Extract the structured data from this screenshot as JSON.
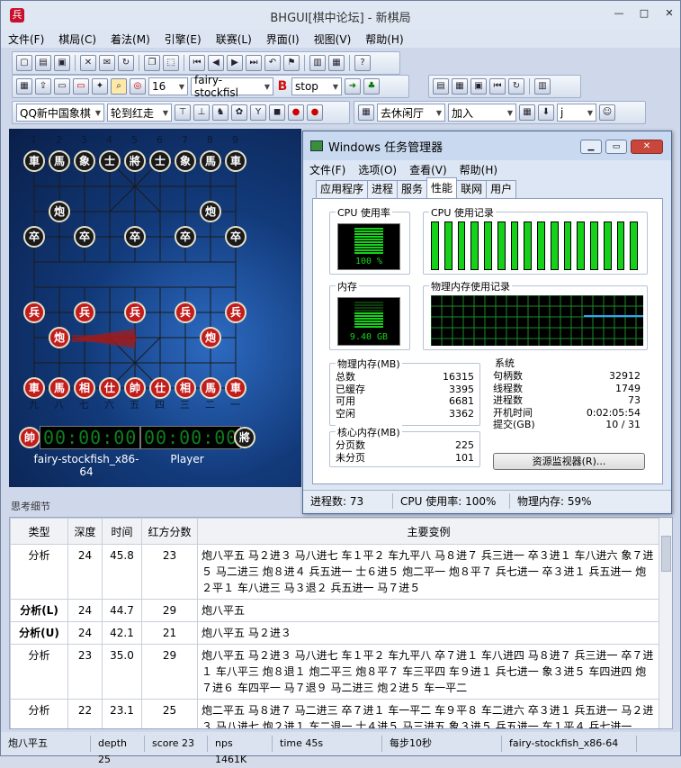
{
  "app": {
    "title": "BHGUI[棋中论坛] - 新棋局",
    "icon_glyph": "兵",
    "win_min": "—",
    "win_max": "□",
    "win_close": "✕"
  },
  "menu": [
    "文件(F)",
    "棋局(C)",
    "着法(M)",
    "引擎(E)",
    "联赛(L)",
    "界面(I)",
    "视图(V)",
    "帮助(H)"
  ],
  "toolbar": {
    "depth_value": "16",
    "engine_value": "fairy-stockfisl",
    "b_label": "B",
    "stop_value": "stop",
    "mode_value": "QQ新中国象棋",
    "turn_value": "轮到红走",
    "room_value": "去休闲厅",
    "join_value": "加入",
    "j_value": "j"
  },
  "board": {
    "top_numbers": [
      "1",
      "2",
      "3",
      "4",
      "5",
      "6",
      "7",
      "8",
      "9"
    ],
    "bottom_numbers": [
      "九",
      "八",
      "七",
      "六",
      "五",
      "四",
      "三",
      "二",
      "一"
    ],
    "black_back": [
      "車",
      "馬",
      "象",
      "士",
      "將",
      "士",
      "象",
      "馬",
      "車"
    ],
    "black_cannon": "炮",
    "black_pawn": "卒",
    "red_pawn": "兵",
    "red_cannon": "炮",
    "red_back": [
      "車",
      "馬",
      "相",
      "仕",
      "帥",
      "仕",
      "相",
      "馬",
      "車"
    ],
    "red_general_badge": "帥",
    "black_general_badge": "將",
    "red_timer": "00:00:00",
    "black_timer": "00:00:00",
    "red_player": "fairy-stockfish_x86-64",
    "black_player": "Player"
  },
  "analysis": {
    "section_title": "思考细节",
    "columns": [
      "类型",
      "深度",
      "时间",
      "红方分数",
      "主要变例"
    ],
    "rows": [
      {
        "type": "分析",
        "depth": "24",
        "time": "45.8",
        "score": "23",
        "pv": "炮八平五 马２进３ 马八进七 车１平２ 车九平八 马８进７ 兵三进一 卒３进１ 车八进六 象７进５ 马二进三 炮８进４ 兵五进一 士６进５ 炮二平一 炮８平７ 兵七进一 卒３进１ 兵五进一 炮２平１ 车八进三 马３退２ 兵五进一 马７进５",
        "bold": false
      },
      {
        "type": "分析(L)",
        "depth": "24",
        "time": "44.7",
        "score": "29",
        "pv": "炮八平五",
        "bold": true
      },
      {
        "type": "分析(U)",
        "depth": "24",
        "time": "42.1",
        "score": "21",
        "pv": "炮八平五 马２进３",
        "bold": true
      },
      {
        "type": "分析",
        "depth": "23",
        "time": "35.0",
        "score": "29",
        "pv": "炮八平五 马２进３ 马八进七 车１平２ 车九平八 卒７进１ 车八进四 马８进７ 兵三进一 卒７进１ 车八平三 炮８退１ 炮二平三 炮８平７ 车三平四 车９进１ 兵七进一 象３进５ 车四进四 炮７进６ 车四平一 马７退９ 马二进三 炮２进５ 车一平二",
        "bold": false
      },
      {
        "type": "分析",
        "depth": "22",
        "time": "23.1",
        "score": "25",
        "pv": "炮二平五 马８进７ 马二进三 卒７进１ 车一平二 车９平８ 车二进六 卒３进１ 兵五进一 马２进３ 马八进七 炮２进１ 车二退一 士４进５ 马三进五 象３进５ 兵五进一 车１平４ 兵七进一",
        "bold": false
      }
    ]
  },
  "status": {
    "move": "炮八平五",
    "depth": "depth 25",
    "score": "score 23",
    "nps": "nps 1461K",
    "time": "time 45s",
    "per_step": "每步10秒",
    "engine": "fairy-stockfish_x86-64"
  },
  "taskmgr": {
    "title": "Windows 任务管理器",
    "menu": [
      "文件(F)",
      "选项(O)",
      "查看(V)",
      "帮助(H)"
    ],
    "tabs": [
      "应用程序",
      "进程",
      "服务",
      "性能",
      "联网",
      "用户"
    ],
    "active_tab": 3,
    "cpu_usage_label": "CPU 使用率",
    "cpu_history_label": "CPU 使用记录",
    "cpu_percent": "100 %",
    "cpu_level": 1.0,
    "mem_label": "内存",
    "mem_history_label": "物理内存使用记录",
    "mem_value": "9.40 GB",
    "mem_level": 0.59,
    "phys_mem_title": "物理内存(MB)",
    "phys_mem": [
      [
        "总数",
        "16315"
      ],
      [
        "已缓存",
        "3395"
      ],
      [
        "可用",
        "6681"
      ],
      [
        "空闲",
        "3362"
      ]
    ],
    "kernel_mem_title": "核心内存(MB)",
    "kernel_mem": [
      [
        "分页数",
        "225"
      ],
      [
        "未分页",
        "101"
      ]
    ],
    "system_title": "系统",
    "system": [
      [
        "句柄数",
        "32912"
      ],
      [
        "线程数",
        "1749"
      ],
      [
        "进程数",
        "73"
      ],
      [
        "开机时间",
        "0:02:05:54"
      ],
      [
        "提交(GB)",
        "10 / 31"
      ]
    ],
    "resmon_button": "资源监视器(R)...",
    "status_procs": "进程数: 73",
    "status_cpu": "CPU 使用率: 100%",
    "status_mem": "物理内存: 59%",
    "colors": {
      "meter_green": "#16d11a",
      "graph_line": "#1c8a2a"
    }
  }
}
